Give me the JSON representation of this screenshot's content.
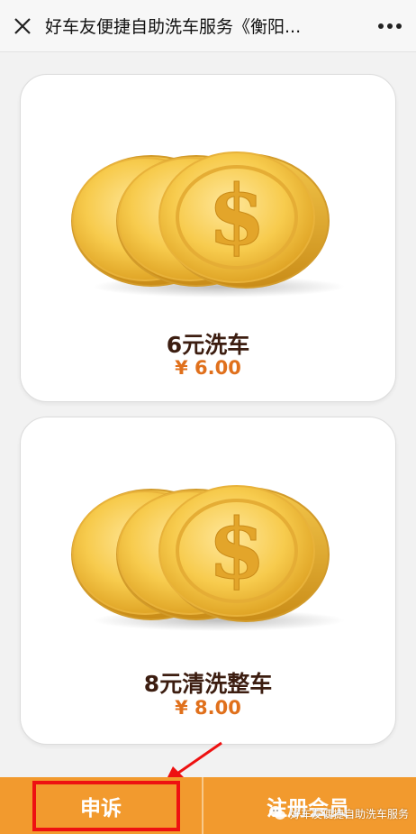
{
  "header": {
    "title": "好车友便捷自助洗车服务《衡阳...",
    "close_icon": "close-icon",
    "more_icon": "more-dots-icon"
  },
  "products": [
    {
      "name": "6元洗车",
      "price": "¥ 6.00",
      "icon": "gold-coins-icon"
    },
    {
      "name": "8元清洗整车",
      "price": "¥ 8.00",
      "icon": "gold-coins-icon"
    }
  ],
  "bottom_bar": {
    "complaint_label": "申诉",
    "register_label": "注册会员"
  },
  "watermark": {
    "text": "好车友便捷自助洗车服务"
  },
  "colors": {
    "bottom_bar": "#f29a2e",
    "price": "#e0701c",
    "product_name": "#3c1d10",
    "highlight": "#ee1111"
  }
}
